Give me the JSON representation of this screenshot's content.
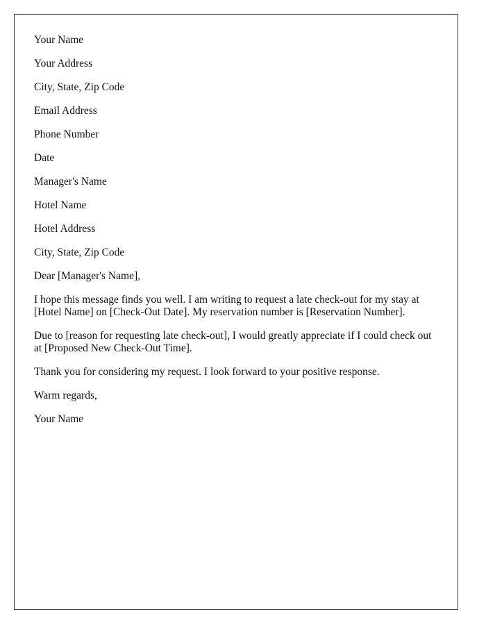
{
  "sender": {
    "name": "Your Name",
    "address": "Your Address",
    "city_state_zip": "City, State, Zip Code",
    "email": "Email Address",
    "phone": "Phone Number"
  },
  "date": "Date",
  "recipient": {
    "name": "Manager's Name",
    "hotel": "Hotel Name",
    "address": "Hotel Address",
    "city_state_zip": "City, State, Zip Code"
  },
  "salutation": "Dear [Manager's Name],",
  "body": [
    "I hope this message finds you well. I am writing to request a late check-out for my stay at [Hotel Name] on [Check-Out Date]. My reservation number is [Reservation Number].",
    "Due to [reason for requesting late check-out], I would greatly appreciate if I could check out at [Proposed New Check-Out Time].",
    "Thank you for considering my request. I look forward to your positive response."
  ],
  "closing": "Warm regards,",
  "signature": "Your Name"
}
